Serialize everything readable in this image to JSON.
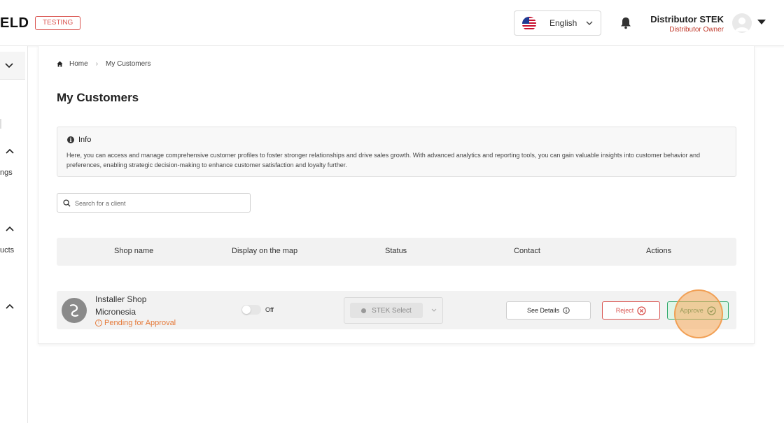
{
  "header": {
    "logo_text": "ELD",
    "env_badge": "TESTING",
    "language": "English",
    "user_name": "Distributor STEK",
    "user_role": "Distributor Owner"
  },
  "sidebar": {
    "partial_labels": [
      "ngs",
      "ucts"
    ]
  },
  "breadcrumb": {
    "home": "Home",
    "separator": "›",
    "current": "My Customers"
  },
  "page": {
    "title": "My Customers"
  },
  "info": {
    "title": "Info",
    "text": "Here, you can access and manage comprehensive customer profiles to foster stronger relationships and drive sales growth. With advanced analytics and reporting tools, you can gain valuable insights into customer behavior and preferences, enabling strategic decision-making to enhance customer satisfaction and loyalty further."
  },
  "search": {
    "placeholder": "Search for a client",
    "value": ""
  },
  "table": {
    "columns": [
      "Shop name",
      "Display on the map",
      "Status",
      "Contact",
      "Actions"
    ],
    "rows": [
      {
        "shop_name": "Installer Shop Micronesia",
        "pending": "Pending for Approval",
        "map_toggle": "Off",
        "status": "STEK Select",
        "contact_button": "See Details",
        "reject_button": "Reject",
        "approve_button": "Approve"
      }
    ]
  },
  "colors": {
    "accent_red": "#d9534f",
    "pending_orange": "#e57a3a",
    "approve_green": "#2fa86b"
  }
}
